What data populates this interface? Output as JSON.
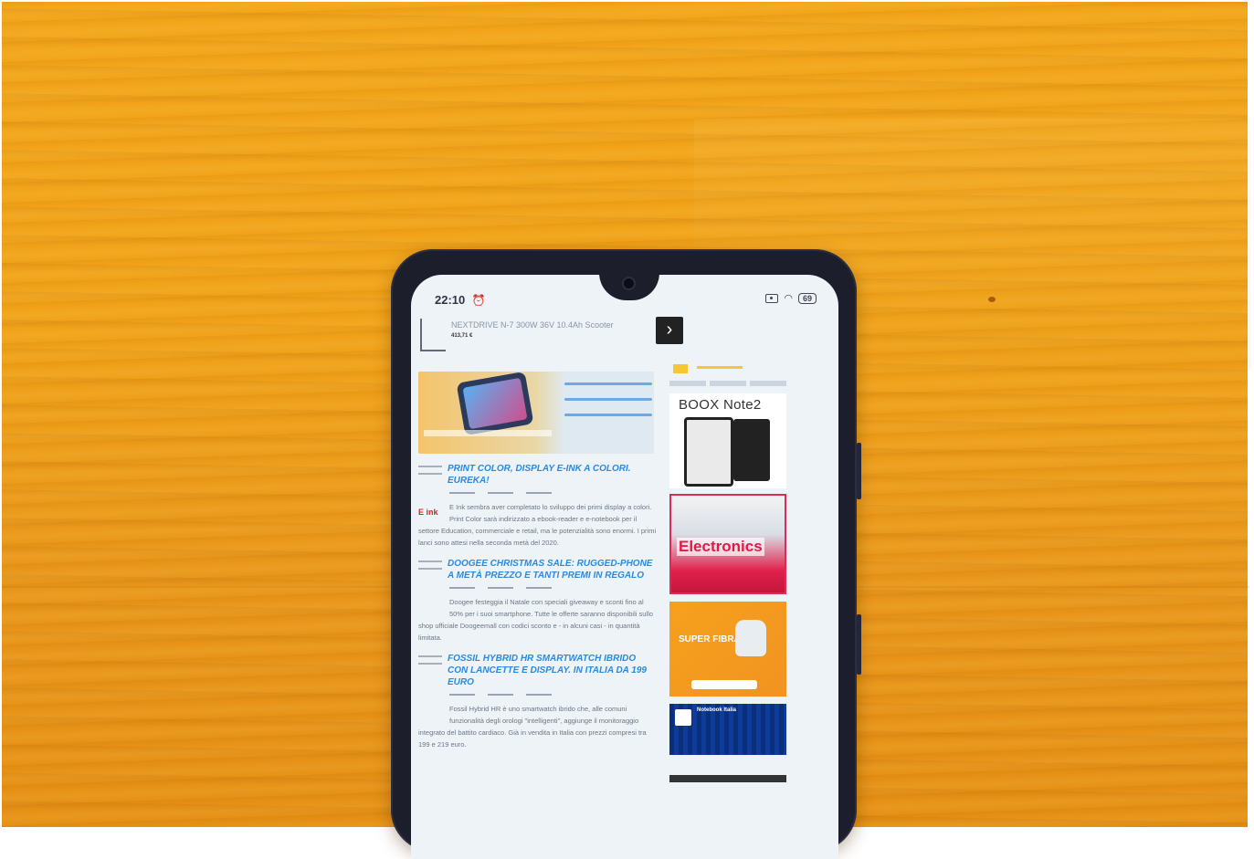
{
  "status_bar": {
    "time": "22:10",
    "alarm_icon": "alarm-icon",
    "right_icons": [
      "screen-record-icon",
      "wifi-icon",
      "battery-icon"
    ],
    "battery": "69"
  },
  "top_ad": {
    "title": "NEXTDRIVE N-7 300W 36V 10.4Ah Scooter",
    "price": "413,71 €"
  },
  "articles": [
    {
      "title": "PRINT COLOR, DISPLAY E-INK A COLORI. EUREKA!",
      "logo": "E ink",
      "body": "E Ink sembra aver completato lo sviluppo dei primi display a colori. Print Color sarà indirizzato a ebook-reader e e-notebook per il settore Education, commerciale e retail, ma le potenzialità sono enormi. I primi lanci sono attesi nella seconda metà del 2020."
    },
    {
      "title": "DOOGEE CHRISTMAS SALE: RUGGED-PHONE A METÀ PREZZO E TANTI PREMI IN REGALO",
      "logo": "",
      "body": "Doogee festeggia il Natale con speciali giveaway e sconti fino al 50% per i suoi smartphone. Tutte le offerte saranno disponibili sullo shop ufficiale Doogeemall con codici sconto e - in alcuni casi - in quantità limitata."
    },
    {
      "title": "FOSSIL HYBRID HR SMARTWATCH IBRIDO CON LANCETTE E DISPLAY. IN ITALIA DA 199 EURO",
      "logo": "",
      "body": "Fossil Hybrid HR è uno smartwatch ibrido che, alle comuni funzionalità degli orologi \"intelligenti\", aggiunge il monitoraggio integrato del battito cardiaco. Già in vendita in Italia con prezzi compresi tra 199 e 219 euro."
    }
  ],
  "sidebar": {
    "boox_title": "BOOX Note2",
    "electronics_title": "Electronics",
    "fibra_text": "SUPER FIBRA",
    "notebook_title": "Notebook Italia"
  }
}
